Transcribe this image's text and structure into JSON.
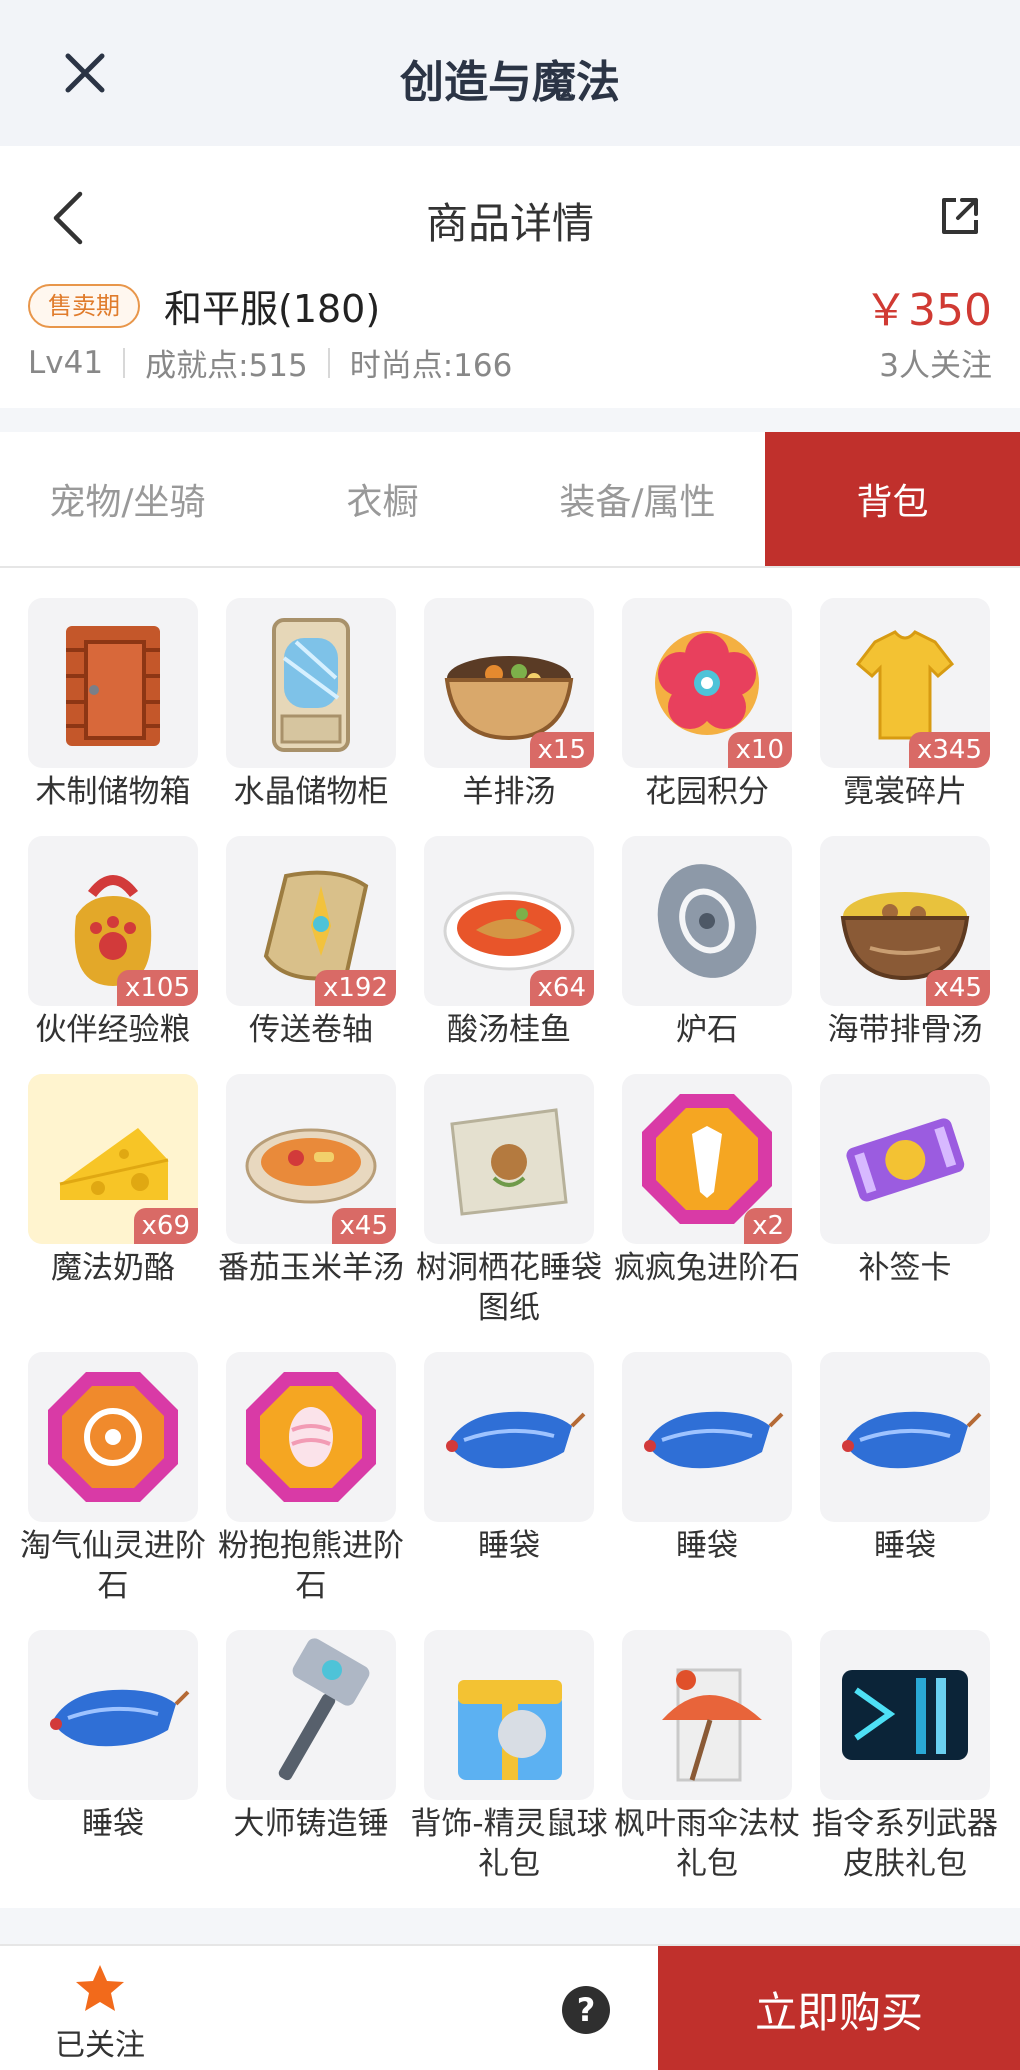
{
  "appbar": {
    "title": "创造与魔法"
  },
  "header": {
    "title": "商品详情",
    "sale_badge": "售卖期",
    "item_name": "和平服(180)",
    "price": "￥350",
    "level": "Lv41",
    "achievement": "成就点:515",
    "fashion": "时尚点:166",
    "followers": "3人关注"
  },
  "tabs": [
    "宠物/坐骑",
    "衣橱",
    "装备/属性",
    "背包"
  ],
  "active_tab": "背包",
  "items": [
    {
      "name": "木制储物箱",
      "qty": "",
      "icon": "wooden-chest"
    },
    {
      "name": "水晶储物柜",
      "qty": "",
      "icon": "crystal-cabinet"
    },
    {
      "name": "羊排汤",
      "qty": "x15",
      "icon": "soup-bowl"
    },
    {
      "name": "花园积分",
      "qty": "x10",
      "icon": "flower-coin"
    },
    {
      "name": "霓裳碎片",
      "qty": "x345",
      "icon": "shirt-shard"
    },
    {
      "name": "伙伴经验粮",
      "qty": "x105",
      "icon": "paw-bag"
    },
    {
      "name": "传送卷轴",
      "qty": "x192",
      "icon": "teleport-scroll"
    },
    {
      "name": "酸汤桂鱼",
      "qty": "x64",
      "icon": "fish-soup"
    },
    {
      "name": "炉石",
      "qty": "",
      "icon": "hearthstone"
    },
    {
      "name": "海带排骨汤",
      "qty": "x45",
      "icon": "rib-soup"
    },
    {
      "name": "魔法奶酪",
      "qty": "x69",
      "icon": "cheese"
    },
    {
      "name": "番茄玉米羊汤",
      "qty": "x45",
      "icon": "tomato-soup"
    },
    {
      "name": "树洞栖花睡袋图纸",
      "qty": "",
      "icon": "blueprint"
    },
    {
      "name": "疯疯兔进阶石",
      "qty": "x2",
      "icon": "gem-rabbit"
    },
    {
      "name": "补签卡",
      "qty": "",
      "icon": "ticket"
    },
    {
      "name": "淘气仙灵进阶石",
      "qty": "",
      "icon": "gem-fairy"
    },
    {
      "name": "粉抱抱熊进阶石",
      "qty": "",
      "icon": "gem-bear"
    },
    {
      "name": "睡袋",
      "qty": "",
      "icon": "sleeping-bag"
    },
    {
      "name": "睡袋",
      "qty": "",
      "icon": "sleeping-bag"
    },
    {
      "name": "睡袋",
      "qty": "",
      "icon": "sleeping-bag"
    },
    {
      "name": "睡袋",
      "qty": "",
      "icon": "sleeping-bag"
    },
    {
      "name": "大师铸造锤",
      "qty": "",
      "icon": "hammer"
    },
    {
      "name": "背饰-精灵鼠球礼包",
      "qty": "",
      "icon": "gift-box"
    },
    {
      "name": "枫叶雨伞法杖礼包",
      "qty": "",
      "icon": "umbrella-pack"
    },
    {
      "name": "指令系列武器皮肤礼包",
      "qty": "",
      "icon": "weapon-skin-pack"
    }
  ],
  "bottom": {
    "follow_label": "已关注",
    "help": "?",
    "buy_label": "立即购买"
  },
  "colors": {
    "accent": "#c0302c",
    "price": "#d03a33",
    "badge": "#e07c2c"
  }
}
